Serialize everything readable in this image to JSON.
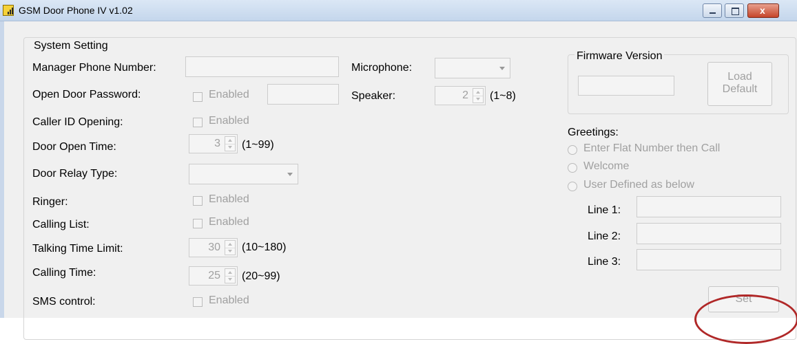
{
  "window": {
    "title": "GSM Door Phone IV v1.02",
    "close_color": "#c5452a"
  },
  "system_setting": {
    "group_label": "System Setting",
    "manager_phone_label": "Manager Phone Number:",
    "manager_phone_value": "",
    "open_door_password_label": "Open Door Password:",
    "open_door_password_enabled_label": "Enabled",
    "open_door_password_value": "",
    "caller_id_label": "Caller ID Opening:",
    "caller_id_enabled_label": "Enabled",
    "door_open_time_label": "Door Open Time:",
    "door_open_time_value": "3",
    "door_open_time_range": "(1~99)",
    "door_relay_type_label": "Door Relay Type:",
    "door_relay_type_value": "",
    "ringer_label": "Ringer:",
    "ringer_enabled_label": "Enabled",
    "calling_list_label": "Calling List:",
    "calling_list_enabled_label": "Enabled",
    "talking_time_label": "Talking Time Limit:",
    "talking_time_value": "30",
    "talking_time_range": "(10~180)",
    "calling_time_label": "Calling Time:",
    "calling_time_value": "25",
    "calling_time_range": "(20~99)",
    "sms_control_label": "SMS control:",
    "sms_control_enabled_label": "Enabled",
    "microphone_label": "Microphone:",
    "microphone_value": "",
    "speaker_label": "Speaker:",
    "speaker_value": "2",
    "speaker_range": "(1~8)"
  },
  "firmware": {
    "group_label": "Firmware Version",
    "version_value": "",
    "load_default_line1": "Load",
    "load_default_line2": "Default"
  },
  "greetings": {
    "label": "Greetings:",
    "options": [
      "Enter Flat Number then Call",
      "Welcome",
      "User Defined as below"
    ],
    "line1_label": "Line 1:",
    "line2_label": "Line 2:",
    "line3_label": "Line 3:",
    "line1_value": "",
    "line2_value": "",
    "line3_value": ""
  },
  "set_button_label": "Set",
  "highlight_color": "#b02828"
}
